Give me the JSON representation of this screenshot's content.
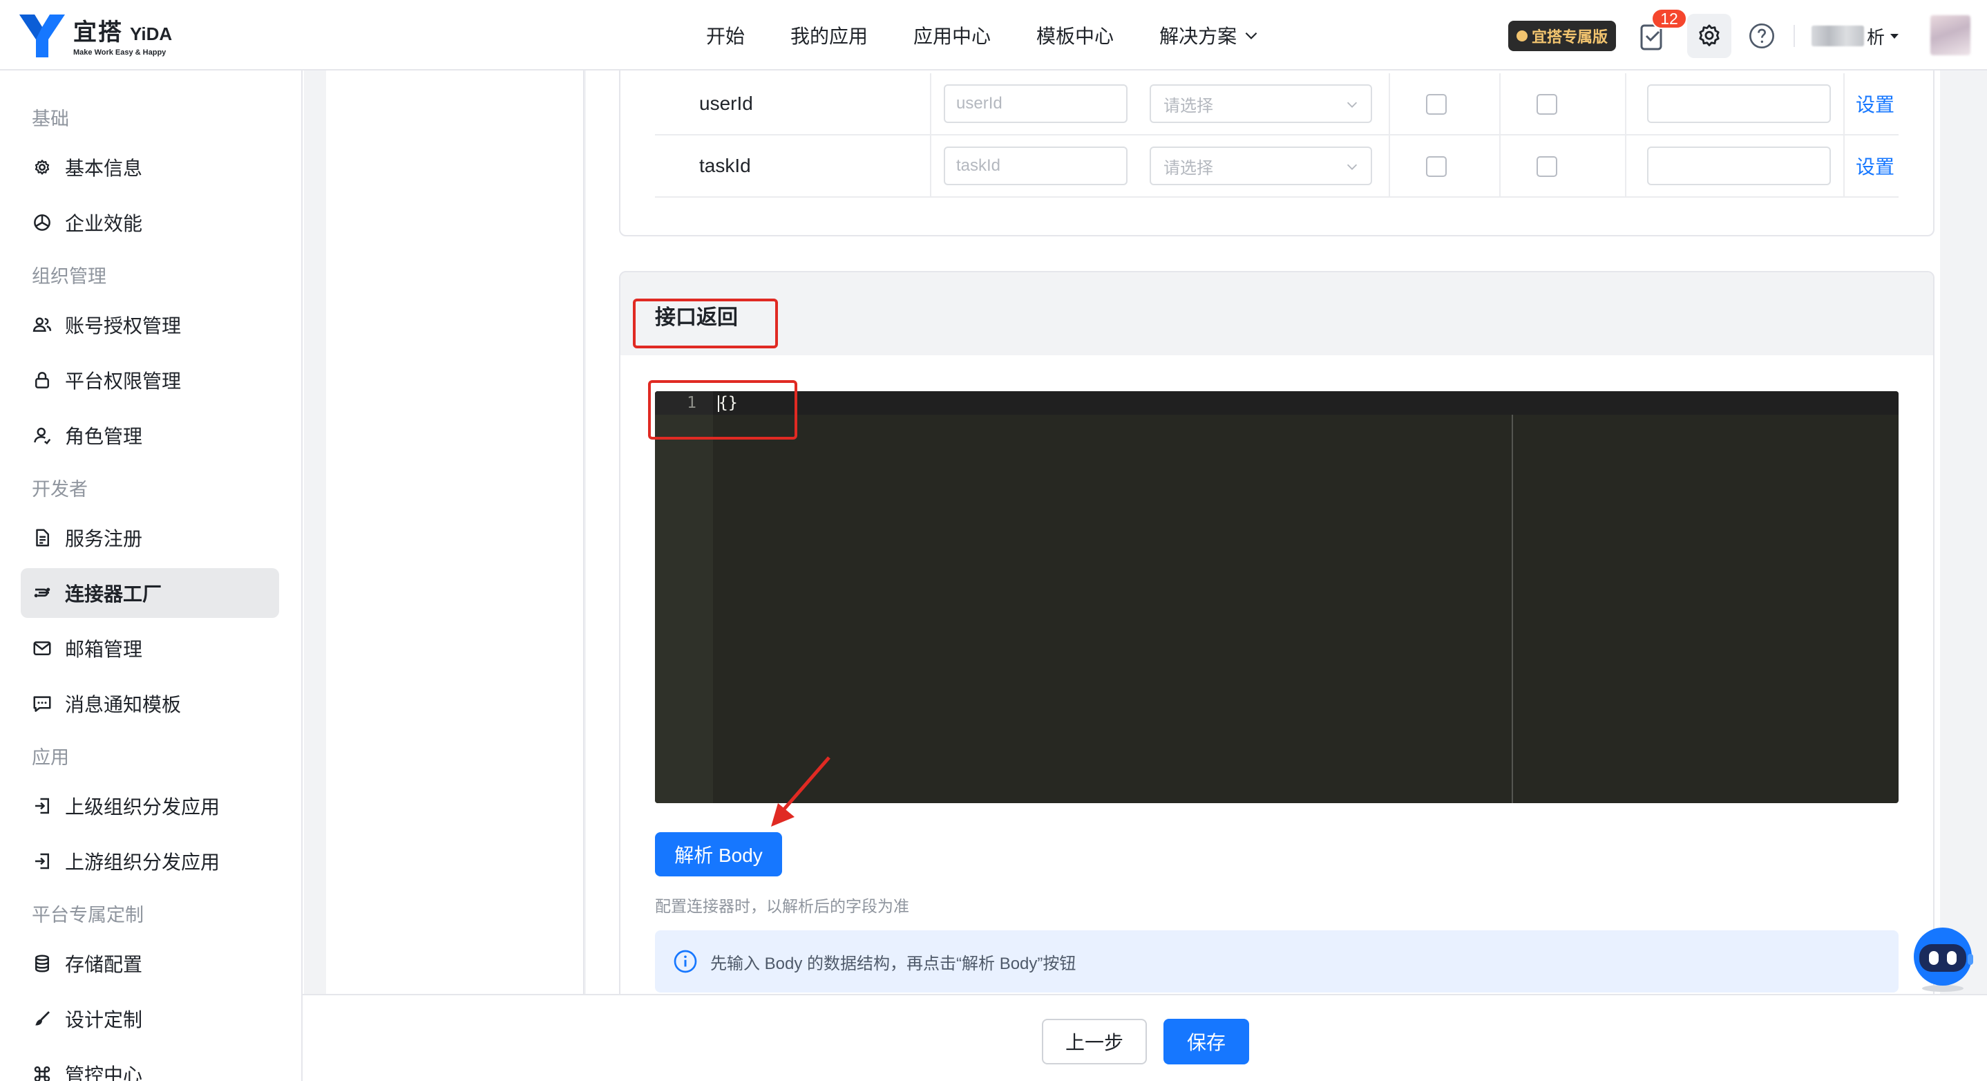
{
  "brand": {
    "name_cn": "宜搭",
    "name_en": "YiDA",
    "slogan": "Make Work Easy & Happy",
    "color": "#1677ff"
  },
  "topnav": {
    "items": [
      "开始",
      "我的应用",
      "应用中心",
      "模板中心",
      "解决方案"
    ]
  },
  "topright": {
    "pro_label": "宜搭专属版",
    "task_count": "12",
    "user_name_suffix": "析"
  },
  "sidebar": {
    "groups": {
      "basic": "基础",
      "org": "组织管理",
      "dev": "开发者",
      "app": "应用",
      "platform": "平台专属定制"
    },
    "items": [
      {
        "label": "基本信息",
        "icon": "gear-icon"
      },
      {
        "label": "企业效能",
        "icon": "pie-chart-icon"
      },
      {
        "label": "账号授权管理",
        "icon": "users-icon"
      },
      {
        "label": "平台权限管理",
        "icon": "lock-icon"
      },
      {
        "label": "角色管理",
        "icon": "user-role-icon"
      },
      {
        "label": "服务注册",
        "icon": "document-icon"
      },
      {
        "label": "连接器工厂",
        "icon": "connector-icon"
      },
      {
        "label": "邮箱管理",
        "icon": "mail-icon"
      },
      {
        "label": "消息通知模板",
        "icon": "message-icon"
      },
      {
        "label": "上级组织分发应用",
        "icon": "login-arrow-icon"
      },
      {
        "label": "上游组织分发应用",
        "icon": "login-arrow-icon"
      },
      {
        "label": "存储配置",
        "icon": "database-icon"
      },
      {
        "label": "设计定制",
        "icon": "brush-icon"
      },
      {
        "label": "管控中心",
        "icon": "command-icon"
      }
    ],
    "active_item": "连接器工厂"
  },
  "params_table": {
    "rows": [
      {
        "name": "userId",
        "input_placeholder": "userId",
        "select_placeholder": "请选择",
        "action": "设置"
      },
      {
        "name": "taskId",
        "input_placeholder": "taskId",
        "select_placeholder": "请选择",
        "action": "设置"
      }
    ]
  },
  "response_section": {
    "title": "接口返回",
    "editor": {
      "line_number": "1",
      "code": "{}"
    },
    "parse_button": "解析 Body",
    "hint": "配置连接器时，以解析后的字段为准",
    "info": "先输入 Body 的数据结构，再点击“解析 Body”按钮"
  },
  "footer": {
    "prev_label": "上一步",
    "save_label": "保存"
  },
  "colors": {
    "primary": "#1677ff",
    "annotation_red": "#e02a23",
    "editor_bg": "#272822",
    "badge_red": "#f5462d"
  }
}
